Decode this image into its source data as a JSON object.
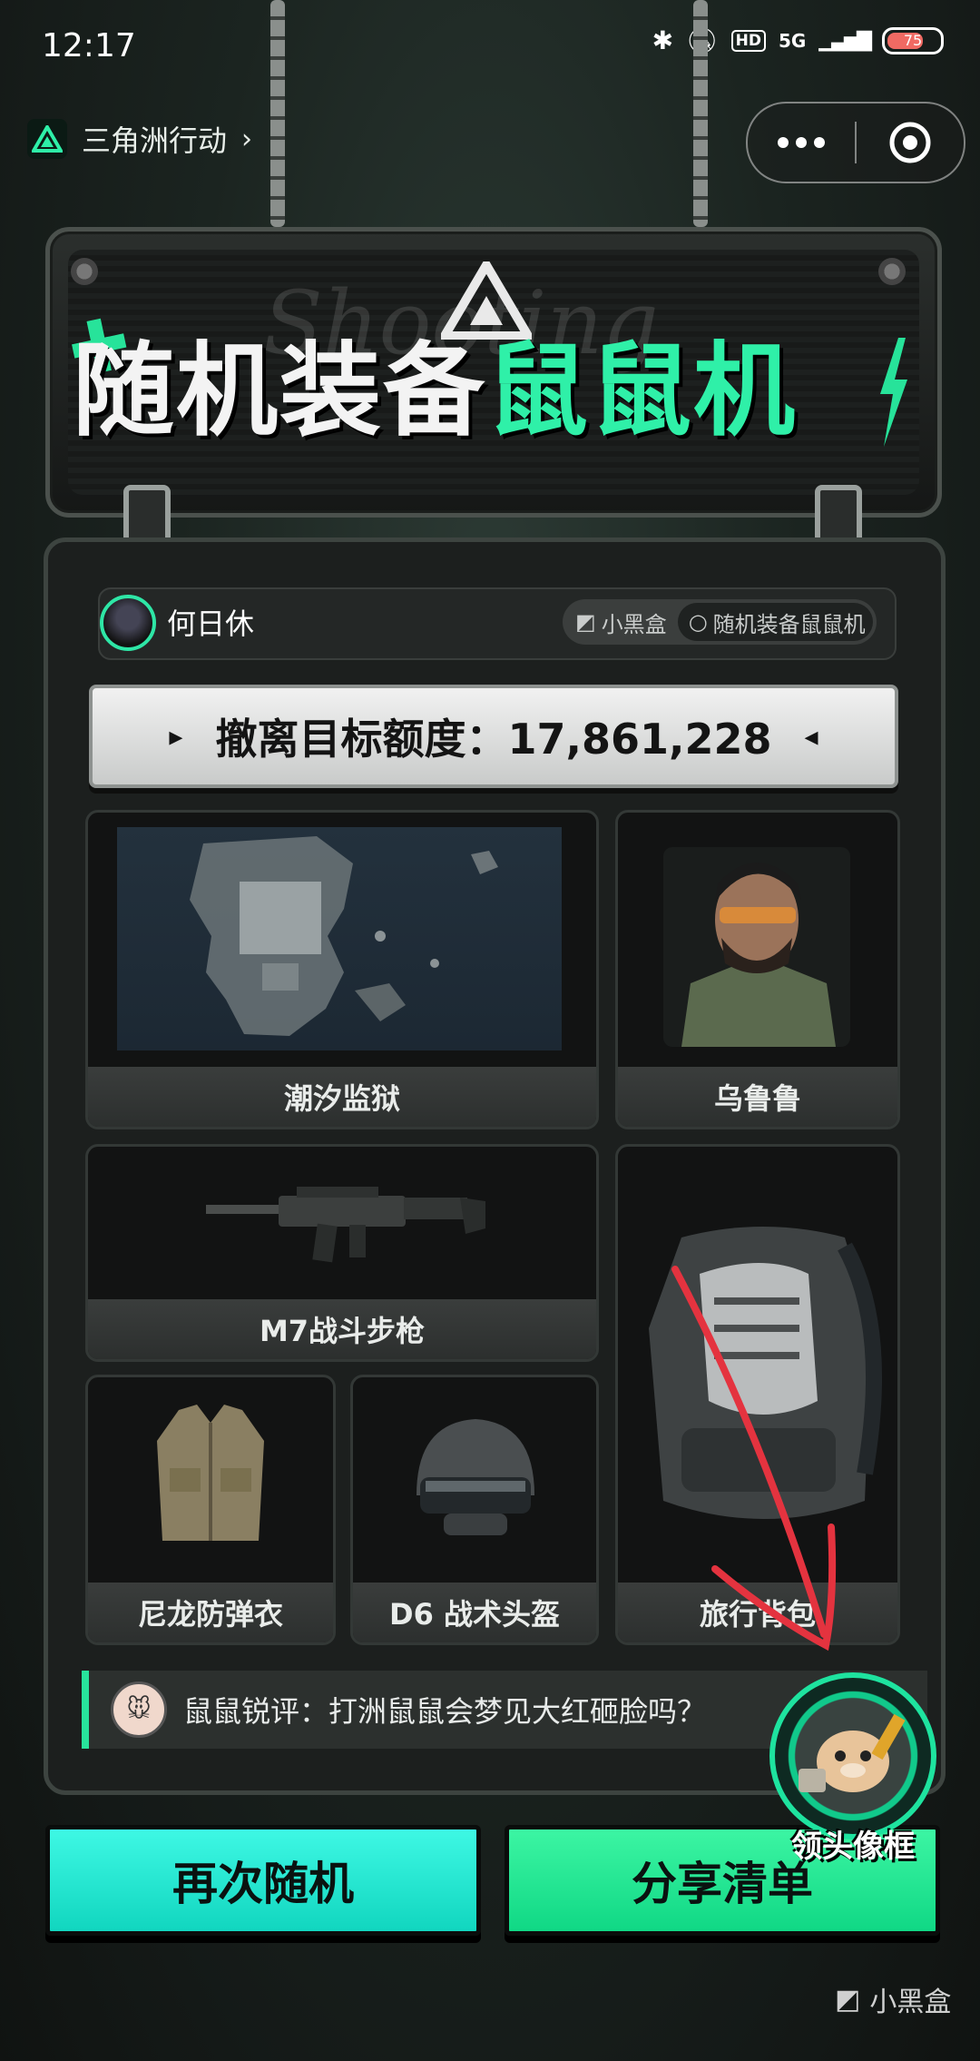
{
  "status_bar": {
    "time": "12:17",
    "hd": "HD",
    "network": "5G",
    "battery_level": 75,
    "battery_text": "75"
  },
  "mini_program": {
    "name": "三角洲行动",
    "more_icon": "more-dots-icon",
    "close_icon": "target-circle-icon"
  },
  "sign": {
    "title_part1": "随机装备",
    "title_part2": "鼠鼠机",
    "ghost_text": "Shooting"
  },
  "user": {
    "name": "何日休",
    "brand": "小黑盒",
    "search_text": "随机装备鼠鼠机"
  },
  "target": {
    "label": "撤离目标额度：17,861,228"
  },
  "cards": {
    "map": "潮汐监狱",
    "operator": "乌鲁鲁",
    "weapon": "M7战斗步枪",
    "backpack": "旅行背包",
    "armor": "尼龙防弹衣",
    "helmet": "D6 战术头盔"
  },
  "review": {
    "text": "鼠鼠锐评：打洲鼠鼠会梦见大红砸脸吗？"
  },
  "buttons": {
    "random": "再次随机",
    "share": "分享清单"
  },
  "badge": {
    "label": "领头像框"
  },
  "watermark": {
    "text": "小黑盒"
  },
  "colors": {
    "accent_green": "#2ff0a8",
    "accent_cyan": "#3ef8e4",
    "annotation_red": "#e4333f"
  }
}
